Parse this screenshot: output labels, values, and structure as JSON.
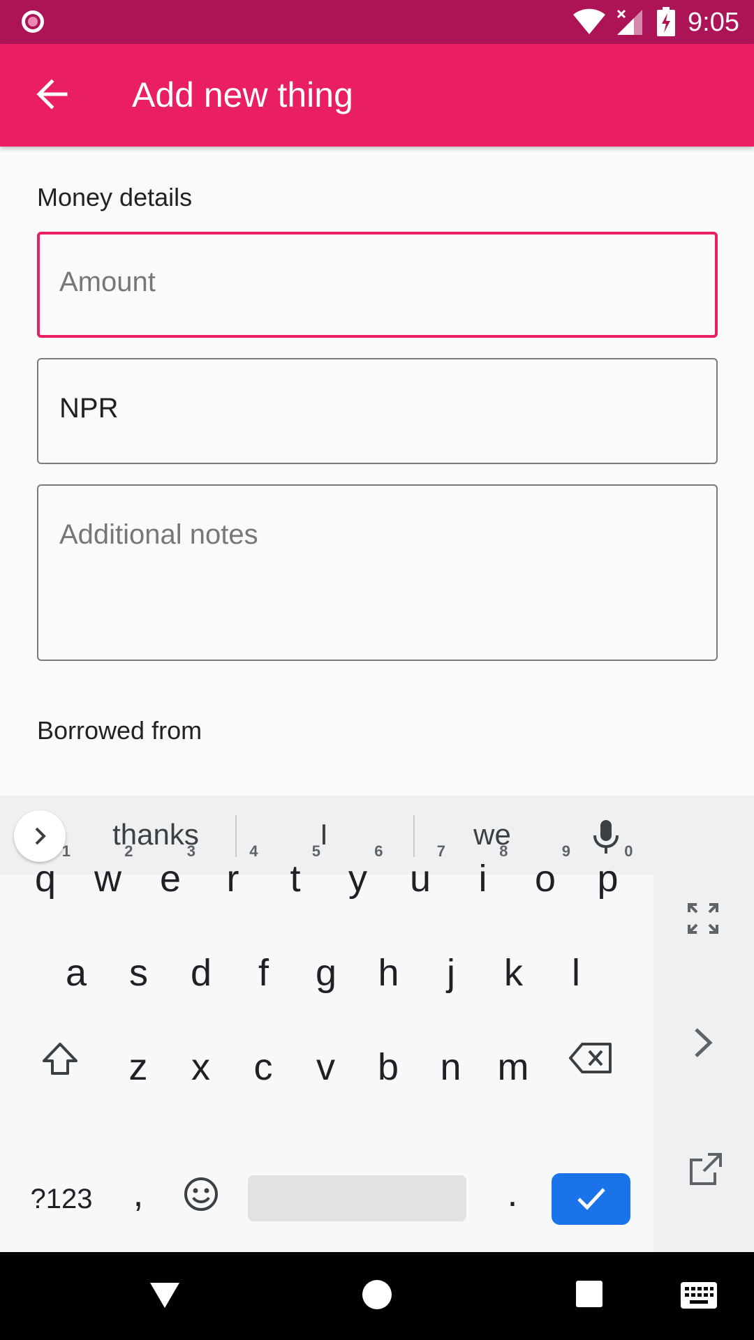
{
  "status_bar": {
    "time": "9:05"
  },
  "app_bar": {
    "title": "Add new thing"
  },
  "form": {
    "section_money": "Money details",
    "amount_placeholder": "Amount",
    "currency_value": "NPR",
    "notes_placeholder": "Additional notes",
    "section_borrowed": "Borrowed from"
  },
  "keyboard": {
    "suggestions": [
      "thanks",
      "I",
      "we"
    ],
    "row1": [
      {
        "k": "q",
        "s": "1"
      },
      {
        "k": "w",
        "s": "2"
      },
      {
        "k": "e",
        "s": "3"
      },
      {
        "k": "r",
        "s": "4"
      },
      {
        "k": "t",
        "s": "5"
      },
      {
        "k": "y",
        "s": "6"
      },
      {
        "k": "u",
        "s": "7"
      },
      {
        "k": "i",
        "s": "8"
      },
      {
        "k": "o",
        "s": "9"
      },
      {
        "k": "p",
        "s": "0"
      }
    ],
    "row2": [
      "a",
      "s",
      "d",
      "f",
      "g",
      "h",
      "j",
      "k",
      "l"
    ],
    "row3": [
      "z",
      "x",
      "c",
      "v",
      "b",
      "n",
      "m"
    ],
    "symbols_label": "?123",
    "comma": ",",
    "period": "."
  },
  "colors": {
    "primary": "#e91e63",
    "primary_dark": "#ad1457",
    "enter_key": "#1a73e8"
  },
  "icons": [
    "record-icon",
    "wifi-icon",
    "signal-icon",
    "battery-charging-icon",
    "back-arrow-icon",
    "chevron-right-icon",
    "mic-icon",
    "fullscreen-icon",
    "shift-icon",
    "backspace-icon",
    "emoji-icon",
    "check-icon",
    "nav-back-icon",
    "nav-home-icon",
    "nav-recents-icon",
    "keyboard-icon"
  ]
}
